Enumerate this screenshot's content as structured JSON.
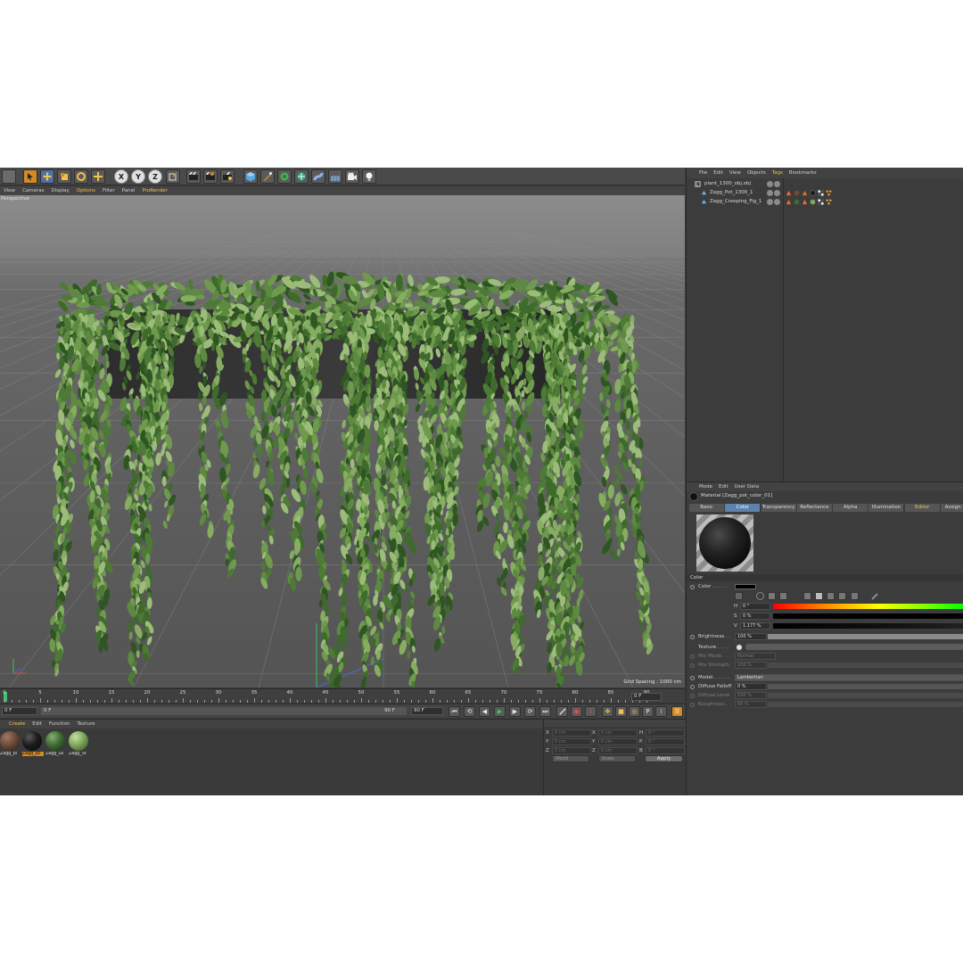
{
  "viewport": {
    "menu": [
      "View",
      "Cameras",
      "Display",
      "Options",
      "Filter",
      "Panel",
      "ProRender"
    ],
    "active_menu_index": 3,
    "label": "Perspective",
    "grid_spacing": "Grid Spacing : 1000 cm"
  },
  "timeline": {
    "ticks": [
      "0",
      "5",
      "10",
      "15",
      "20",
      "25",
      "30",
      "35",
      "40",
      "45",
      "50",
      "55",
      "60",
      "65",
      "70",
      "75",
      "80",
      "85",
      "90"
    ],
    "end_field": "0 F"
  },
  "transport": {
    "current_frame": "0 F",
    "start_field": "0 F",
    "slider_end": "90 F",
    "end_frame": "90 F"
  },
  "material_manager": {
    "menu": [
      "Create",
      "Edit",
      "Function",
      "Texture"
    ],
    "active_menu_index": 0,
    "materials": [
      {
        "name": "Zagg_pl",
        "color": "#6e4a3a",
        "selected": false
      },
      {
        "name": "Zagg_pc",
        "color": "#1c1c1c",
        "selected": true
      },
      {
        "name": "Zagg_Le",
        "color": "#3f6a34",
        "selected": false
      },
      {
        "name": "Zagg_St",
        "color": "#7ea65a",
        "selected": false
      }
    ]
  },
  "coordinates": {
    "rows": [
      {
        "a_lbl": "X",
        "a_val": "0 cm",
        "b_lbl": "X",
        "b_val": "0 cm",
        "c_lbl": "H",
        "c_val": "0 °"
      },
      {
        "a_lbl": "Y",
        "a_val": "0 cm",
        "b_lbl": "Y",
        "b_val": "0 cm",
        "c_lbl": "P",
        "c_val": "0 °"
      },
      {
        "a_lbl": "Z",
        "a_val": "0 cm",
        "b_lbl": "Z",
        "b_val": "0 cm",
        "c_lbl": "B",
        "c_val": "0 °"
      }
    ],
    "mode_select": "World",
    "size_select": "Scale",
    "apply": "Apply"
  },
  "objects": {
    "menu": [
      "File",
      "Edit",
      "View",
      "Objects",
      "Tags",
      "Bookmarks"
    ],
    "active_menu_index": 4,
    "items": [
      {
        "name": "plant_1300_obj.obj",
        "indent": 0
      },
      {
        "name": "Zagg_Pot_1300_1",
        "indent": 1
      },
      {
        "name": "Zagg_Creeping_Fig_1",
        "indent": 1
      }
    ]
  },
  "attributes": {
    "menu": [
      "Mode",
      "Edit",
      "User Data"
    ],
    "material_title": "Material [Zagg_pot_color_01]",
    "tabs": [
      "Basic",
      "Color",
      "Transparency",
      "Reflectance",
      "Alpha",
      "Illumination",
      "Editor",
      "Assign"
    ],
    "active_tab_index": 1,
    "section": "Color",
    "color_label": "Color . . . . .",
    "h_label": "H",
    "h_value": "0 °",
    "s_label": "S",
    "s_value": "0 %",
    "v_label": "V",
    "v_value": "1.177 %",
    "brightness_label": "Brightness . .",
    "brightness_value": "100 %",
    "brightness_fill": 1.0,
    "texture_label": "Texture . . . .",
    "mix_mode_label": "Mix Mode . . .",
    "mix_mode_value": "Normal",
    "mix_strength_label": "Mix Strength",
    "mix_strength_value": "100 %",
    "model_label": "Model. . . . . .",
    "model_value": "Lambertian",
    "diffuse_falloff_label": "Diffuse Falloff",
    "diffuse_falloff_value": "0 %",
    "diffuse_level_label": "Diffuse Level",
    "diffuse_level_value": "100 %",
    "roughness_label": "Roughness . .",
    "roughness_value": "50 %"
  },
  "colors": {
    "accent_blue": "#5b83ad",
    "accent_orange": "#d38a22",
    "highlight_yellow": "#f2c14e",
    "leaf_green": "#4d7a34"
  }
}
